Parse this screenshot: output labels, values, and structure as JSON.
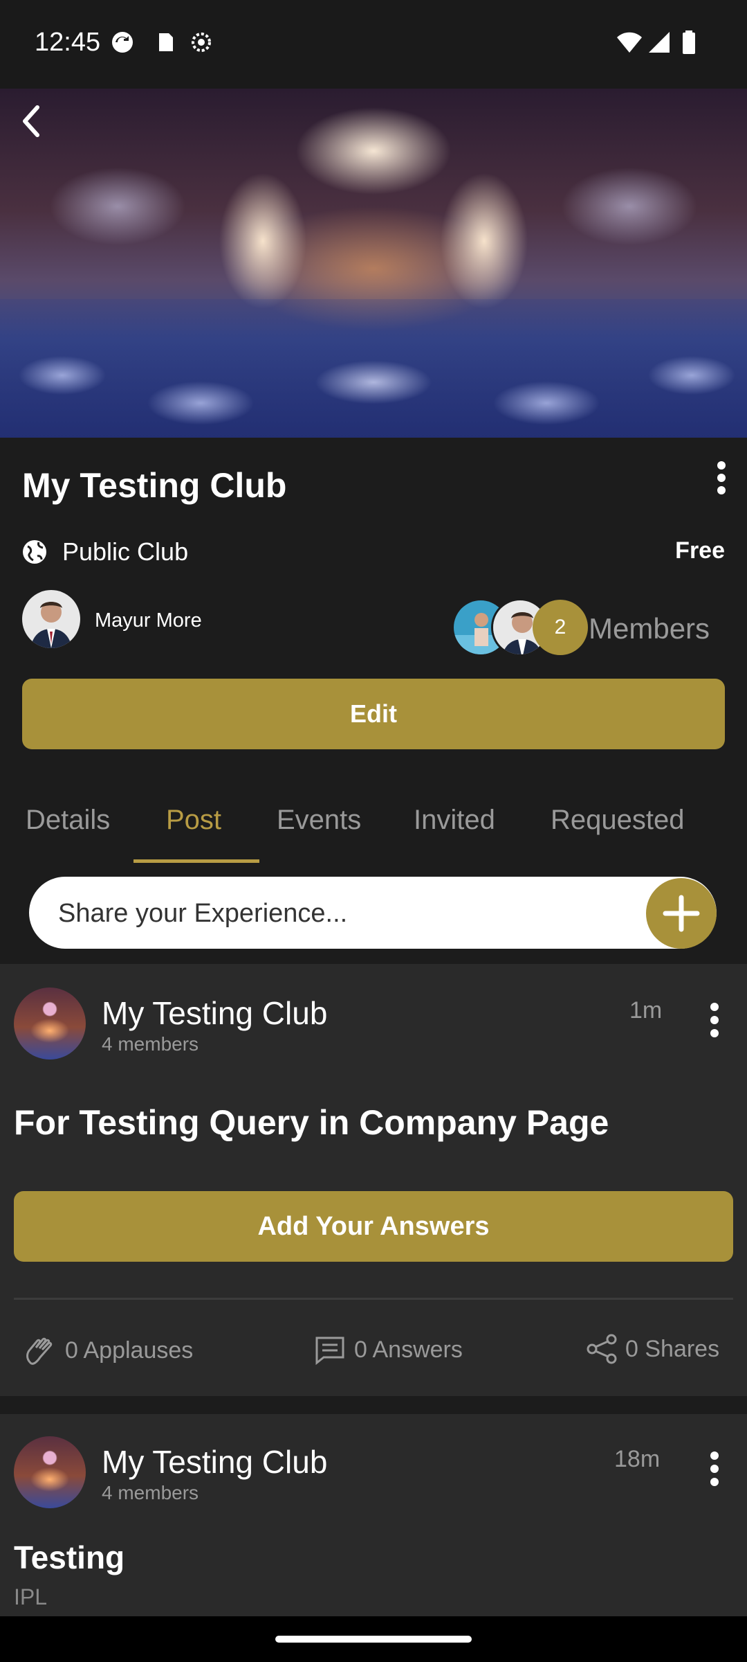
{
  "status_bar": {
    "time": "12:45"
  },
  "club": {
    "title": "My Testing Club",
    "type_label": "Public Club",
    "price_label": "Free",
    "owner_name": "Mayur More",
    "member_count": "2",
    "members_label": "Members",
    "edit_label": "Edit"
  },
  "tabs": [
    {
      "label": "Details",
      "active": false
    },
    {
      "label": "Post",
      "active": true
    },
    {
      "label": "Events",
      "active": false
    },
    {
      "label": "Invited",
      "active": false
    },
    {
      "label": "Requested",
      "active": false
    }
  ],
  "share": {
    "placeholder": "Share your Experience..."
  },
  "posts": [
    {
      "author": "My Testing Club",
      "subtitle": "4 members",
      "time": "1m",
      "question": "For Testing Query in Company Page",
      "answer_button": "Add Your Answers",
      "applauses": "0 Applauses",
      "answers": "0 Answers",
      "shares": "0 Shares"
    },
    {
      "author": "My Testing Club",
      "subtitle": "4 members",
      "time": "18m",
      "question": "Testing",
      "body": "IPL"
    }
  ],
  "colors": {
    "accent": "#a8913a",
    "tab_active": "#b89c44",
    "background": "#1c1c1c",
    "card": "#2a2a2a"
  }
}
